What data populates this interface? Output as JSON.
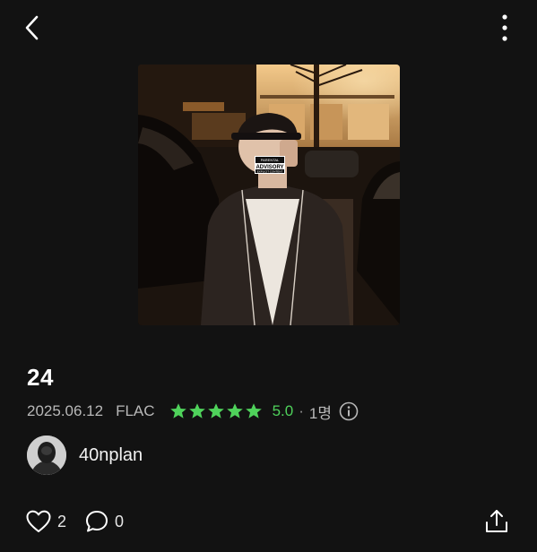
{
  "header": {
    "back_icon": "chevron-left-icon",
    "more_icon": "more-vertical-icon"
  },
  "cover": {
    "advisory_line1": "PARENTAL",
    "advisory_line2": "ADVISORY",
    "advisory_line3": "EXPLICIT CONTENT"
  },
  "track": {
    "title": "24",
    "date": "2025.06.12",
    "format": "FLAC",
    "stars": 5,
    "rating": "5.0",
    "separator": "·",
    "rater_count": "1명"
  },
  "artist": {
    "name": "40nplan"
  },
  "actions": {
    "likes": "2",
    "comments": "0"
  },
  "colors": {
    "background": "#121212",
    "accent_green": "#4fd25b",
    "meta_text": "#b8b8b8"
  }
}
